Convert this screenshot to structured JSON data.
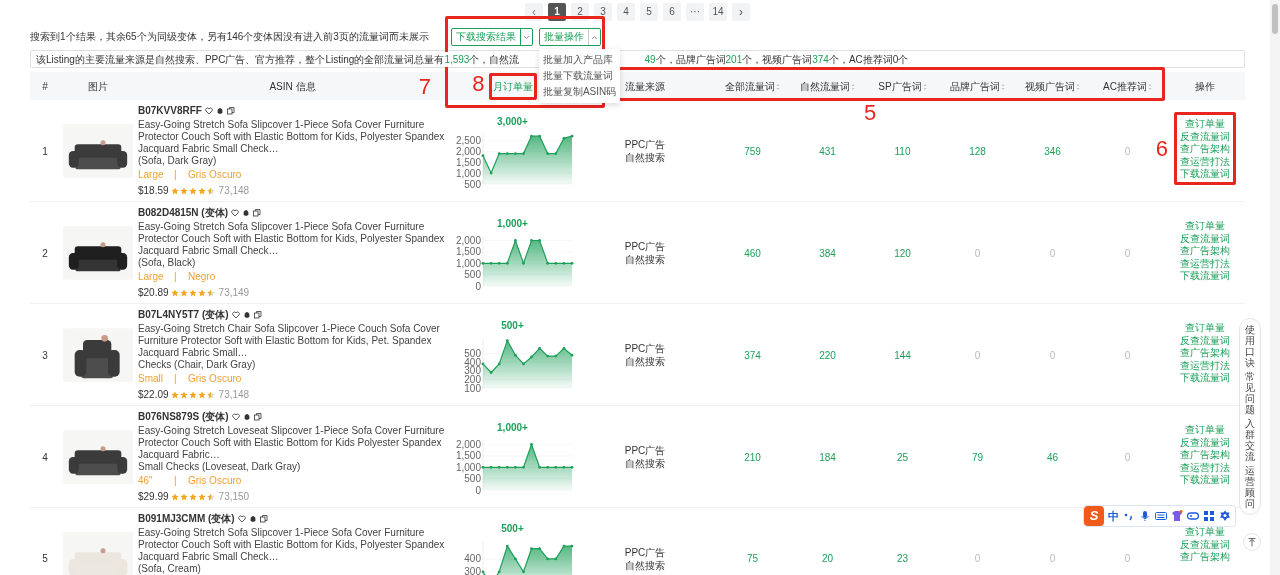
{
  "pagination": [
    {
      "label": "‹",
      "kind": "arrow",
      "selected": false,
      "disabled": true
    },
    {
      "label": "1",
      "kind": "page",
      "selected": true,
      "disabled": false
    },
    {
      "label": "2",
      "kind": "page",
      "selected": false,
      "disabled": false
    },
    {
      "label": "3",
      "kind": "page",
      "selected": false,
      "disabled": false
    },
    {
      "label": "4",
      "kind": "page",
      "selected": false,
      "disabled": false
    },
    {
      "label": "5",
      "kind": "page",
      "selected": false,
      "disabled": false
    },
    {
      "label": "6",
      "kind": "page",
      "selected": false,
      "disabled": false
    },
    {
      "label": "···",
      "kind": "page",
      "selected": false,
      "disabled": false
    },
    {
      "label": "14",
      "kind": "page",
      "selected": false,
      "disabled": false
    },
    {
      "label": "›",
      "kind": "arrow",
      "selected": false,
      "disabled": false
    }
  ],
  "summary": "搜索到1个结果，其余65个为同级变体，另有146个变体因没有进入前3页的流量词而未展示",
  "toolbar": [
    {
      "label": "下载搜索结果",
      "split": true,
      "expanded": false
    },
    {
      "label": "批量操作",
      "split": false,
      "expanded": true
    }
  ],
  "dropdown": [
    "批量加入产品库",
    "批量下载流量词",
    "批量复制ASIN码"
  ],
  "info_before": [
    {
      "text": "该Listing的主要流量来源是自然搜索、PPC广告、官方推荐，整个Listing的全部流量词总量有",
      "highlight": false
    },
    {
      "text": "1,593",
      "highlight": true
    },
    {
      "text": "个，自然流",
      "highlight": false
    }
  ],
  "info_after": [
    {
      "text": "49",
      "highlight": true
    },
    {
      "text": "个，品牌广告词",
      "highlight": false
    },
    {
      "text": "201",
      "highlight": true
    },
    {
      "text": "个，视频广告词",
      "highlight": false
    },
    {
      "text": "374",
      "highlight": true
    },
    {
      "text": "个，AC推荐词0个",
      "highlight": false
    }
  ],
  "columns": [
    {
      "label": "#",
      "sortable": false,
      "active": false
    },
    {
      "label": "图片",
      "sortable": false,
      "active": false
    },
    {
      "label": "ASIN 信息",
      "sortable": false,
      "active": false
    },
    {
      "label": "月订单量",
      "sortable": false,
      "active": true
    },
    {
      "label": "流量来源",
      "sortable": false,
      "active": false
    },
    {
      "label": "全部流量词",
      "sortable": true,
      "active": false
    },
    {
      "label": "自然流量词",
      "sortable": true,
      "active": false
    },
    {
      "label": "SP广告词",
      "sortable": true,
      "active": false
    },
    {
      "label": "品牌广告词",
      "sortable": true,
      "active": false
    },
    {
      "label": "视频广告词",
      "sortable": true,
      "active": false
    },
    {
      "label": "AC推荐词",
      "sortable": true,
      "active": false
    },
    {
      "label": "操作",
      "sortable": false,
      "active": false
    }
  ],
  "rows": [
    {
      "index": "1",
      "asin": "B07KVV8RFF",
      "variant_tag": "",
      "title": "Easy-Going Stretch Sofa Slipcover 1-Piece Sofa Cover Furniture Protector Couch Soft with Elastic Bottom for Kids, Polyester Spandex Jacquard Fabric Small Check…",
      "style": "(Sofa, Dark Gray)",
      "size": "Large",
      "separator": "|",
      "color_name": "Gris Oscuro",
      "price": "$18.59",
      "stars": 4.5,
      "reviews": "73,148",
      "orders": "3,000+",
      "chart_data": {
        "type": "area",
        "values": [
          1800,
          1000,
          1900,
          1900,
          1900,
          1900,
          2700,
          2700,
          1900,
          1900,
          2600,
          2700
        ],
        "ylim": [
          500,
          2800
        ],
        "grid": true,
        "yticks": [
          {
            "value": 500,
            "label": "500"
          },
          {
            "value": 1000,
            "label": "1,000"
          },
          {
            "value": 1500,
            "label": "1,500"
          },
          {
            "value": 2000,
            "label": "2,000"
          },
          {
            "value": 2500,
            "label": "2,500"
          }
        ]
      },
      "sources": [
        "PPC广告",
        "自然搜索"
      ],
      "metrics": [
        {
          "text": "759",
          "highlight": true
        },
        {
          "text": "431",
          "highlight": true
        },
        {
          "text": "110",
          "highlight": true
        },
        {
          "text": "128",
          "highlight": true
        },
        {
          "text": "346",
          "highlight": true
        },
        {
          "text": "0",
          "highlight": false
        }
      ],
      "actions": [
        "查订单量",
        "反查流量词",
        "查广告架构",
        "查运营打法",
        "下载流量词"
      ]
    },
    {
      "index": "2",
      "asin": "B082D4815N",
      "variant_tag": "(变体)",
      "title": "Easy-Going Stretch Sofa Slipcover 1-Piece Sofa Cover Furniture Protector Couch Soft with Elastic Bottom for Kids, Polyester Spandex Jacquard Fabric Small Check…",
      "style": "(Sofa, Black)",
      "size": "Large",
      "separator": "|",
      "color_name": "Negro",
      "price": "$20.89",
      "stars": 4.5,
      "reviews": "73,149",
      "orders": "1,000+",
      "chart_data": {
        "type": "area",
        "values": [
          1000,
          1000,
          1000,
          1000,
          2000,
          1000,
          2000,
          2000,
          1000,
          1000,
          1000,
          1000
        ],
        "ylim": [
          0,
          2200
        ],
        "grid": true,
        "yticks": [
          {
            "value": 0,
            "label": "0"
          },
          {
            "value": 500,
            "label": "500"
          },
          {
            "value": 1000,
            "label": "1,000"
          },
          {
            "value": 1500,
            "label": "1,500"
          },
          {
            "value": 2000,
            "label": "2,000"
          }
        ]
      },
      "sources": [
        "PPC广告",
        "自然搜索"
      ],
      "metrics": [
        {
          "text": "460",
          "highlight": true
        },
        {
          "text": "384",
          "highlight": true
        },
        {
          "text": "120",
          "highlight": true
        },
        {
          "text": "0",
          "highlight": false
        },
        {
          "text": "0",
          "highlight": false
        },
        {
          "text": "0",
          "highlight": false
        }
      ],
      "actions": [
        "查订单量",
        "反查流量词",
        "查广告架构",
        "查运营打法",
        "下载流量词"
      ]
    },
    {
      "index": "3",
      "asin": "B07L4NY5T7",
      "variant_tag": "(变体)",
      "title": "Easy-Going Stretch Chair Sofa Slipcover 1-Piece Couch Sofa Cover Furniture Protector Soft with Elastic Bottom for Kids, Pet. Spandex Jacquard Fabric Small…",
      "style": "Checks (Chair, Dark Gray)",
      "size": "Small",
      "separator": "|",
      "color_name": "Gris Oscuro",
      "price": "$22.09",
      "stars": 4.5,
      "reviews": "73,148",
      "orders": "500+",
      "chart_data": {
        "type": "area",
        "values": [
          380,
          280,
          380,
          650,
          480,
          380,
          460,
          560,
          470,
          470,
          560,
          480
        ],
        "ylim": [
          100,
          680
        ],
        "grid": true,
        "yticks": [
          {
            "value": 100,
            "label": "100"
          },
          {
            "value": 200,
            "label": "200"
          },
          {
            "value": 300,
            "label": "300"
          },
          {
            "value": 400,
            "label": "400"
          },
          {
            "value": 500,
            "label": "500"
          }
        ]
      },
      "sources": [
        "PPC广告",
        "自然搜索"
      ],
      "metrics": [
        {
          "text": "374",
          "highlight": true
        },
        {
          "text": "220",
          "highlight": true
        },
        {
          "text": "144",
          "highlight": true
        },
        {
          "text": "0",
          "highlight": false
        },
        {
          "text": "0",
          "highlight": false
        },
        {
          "text": "0",
          "highlight": false
        }
      ],
      "actions": [
        "查订单量",
        "反查流量词",
        "查广告架构",
        "查运营打法",
        "下载流量词"
      ]
    },
    {
      "index": "4",
      "asin": "B076NS879S",
      "variant_tag": "(变体)",
      "title": "Easy-Going Stretch Loveseat Slipcover 1-Piece Sofa Cover Furniture Protector Couch Soft with Elastic Bottom for Kids Polyester Spandex Jacquard Fabric…",
      "style": "Small Checks (Loveseat, Dark Gray)",
      "size": "46\"",
      "separator": "|",
      "color_name": "Gris Oscuro",
      "price": "$29.99",
      "stars": 4.5,
      "reviews": "73,150",
      "orders": "1,000+",
      "chart_data": {
        "type": "area",
        "values": [
          1000,
          1000,
          1000,
          1000,
          1000,
          1000,
          2000,
          1000,
          1000,
          1000,
          1000,
          1000
        ],
        "ylim": [
          0,
          2200
        ],
        "grid": true,
        "yticks": [
          {
            "value": 0,
            "label": "0"
          },
          {
            "value": 500,
            "label": "500"
          },
          {
            "value": 1000,
            "label": "1,000"
          },
          {
            "value": 1500,
            "label": "1,500"
          },
          {
            "value": 2000,
            "label": "2,000"
          }
        ]
      },
      "sources": [
        "PPC广告",
        "自然搜索"
      ],
      "metrics": [
        {
          "text": "210",
          "highlight": true
        },
        {
          "text": "184",
          "highlight": true
        },
        {
          "text": "25",
          "highlight": true
        },
        {
          "text": "79",
          "highlight": true
        },
        {
          "text": "46",
          "highlight": true
        },
        {
          "text": "0",
          "highlight": false
        }
      ],
      "actions": [
        "查订单量",
        "反查流量词",
        "查广告架构",
        "查运营打法",
        "下载流量词"
      ]
    },
    {
      "index": "5",
      "asin": "B091MJ3CMM",
      "variant_tag": "(变体)",
      "title": "Easy-Going Stretch Sofa Slipcover 1-Piece Sofa Cover Furniture Protector Couch Soft with Elastic Bottom for Kids, Polyester Spandex Jacquard Fabric Small Check…",
      "style": "(Sofa, Cream)",
      "orders": "500+",
      "chart_data": {
        "type": "area",
        "values": [
          300,
          200,
          300,
          500,
          400,
          300,
          480,
          480,
          400,
          400,
          500,
          500
        ],
        "ylim": [
          150,
          540
        ],
        "grid": true,
        "yticks": [
          {
            "value": 300,
            "label": "300"
          },
          {
            "value": 400,
            "label": "400"
          }
        ]
      },
      "sources": [
        "PPC广告",
        "自然搜索"
      ],
      "metrics": [
        {
          "text": "75",
          "highlight": true
        },
        {
          "text": "20",
          "highlight": true
        },
        {
          "text": "23",
          "highlight": true
        },
        {
          "text": "0",
          "highlight": false
        },
        {
          "text": "0",
          "highlight": false
        },
        {
          "text": "0",
          "highlight": false
        }
      ],
      "actions": [
        "查订单量",
        "反查流量词",
        "查广告架构"
      ]
    }
  ],
  "side_panel": [
    "使用口诀",
    "常见问题",
    "入群交流",
    "运营顾问"
  ],
  "ime_toolbar": {
    "logo": "S",
    "mode": "中"
  },
  "annotations": [
    {
      "label": "7"
    },
    {
      "label": "8"
    },
    {
      "label": "5"
    },
    {
      "label": "6"
    }
  ]
}
